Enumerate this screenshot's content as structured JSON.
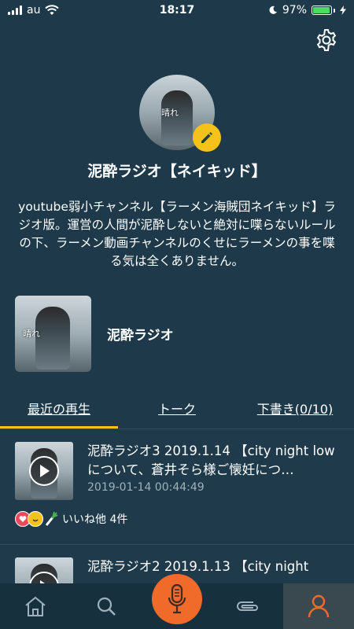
{
  "status_bar": {
    "carrier": "au",
    "time": "18:17",
    "battery_percent": "97%",
    "battery_level": 0.97
  },
  "header": {
    "settings_icon": "gear-icon"
  },
  "profile": {
    "avatar_overlay_text": "晴れ",
    "name": "泥酔ラジオ【ネイキッド】",
    "bio": "youtube弱小チャンネル【ラーメン海賊団ネイキッド】ラジオ版。運営の人間が泥酔しないと絶対に喋らないルールの下、ラーメン動画チャンネルのくせにラーメンの事を喋る気は全くありません。"
  },
  "channel": {
    "name": "泥酔ラジオ",
    "thumb_overlay_text": "晴れ"
  },
  "tabs": [
    {
      "label": "最近の再生",
      "active": true
    },
    {
      "label": "トーク",
      "active": false
    },
    {
      "label": "下書き(0/10)",
      "active": false
    }
  ],
  "plays": [
    {
      "title": "泥酔ラジオ3 2019.1.14 【city night lowについて、蒼井そら様ご懐妊につ…",
      "date": "2019-01-14 00:44:49",
      "likes_text": "いいね他 4件"
    },
    {
      "title": "泥酔ラジオ2 2019.1.13 【city night",
      "date": "",
      "likes_text": ""
    }
  ],
  "colors": {
    "background": "#1e3a4a",
    "accent": "#f5c21b",
    "mic": "#f06a2a",
    "nav_active": "#f06a2a"
  },
  "bottom_nav": {
    "items": [
      "home-icon",
      "search-icon",
      "mic-icon",
      "paperclip-icon",
      "profile-icon"
    ],
    "active": "profile-icon"
  }
}
